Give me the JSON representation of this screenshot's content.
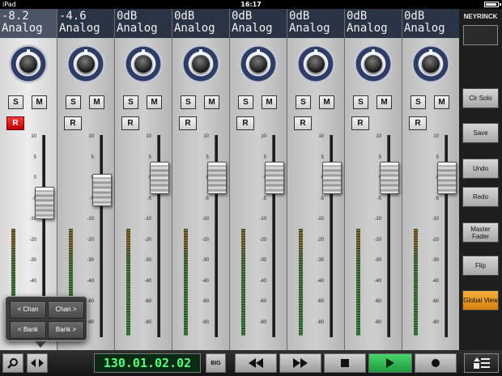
{
  "status": {
    "device": "iPad",
    "time": "16:17"
  },
  "channels": [
    {
      "display": "-8.2",
      "mode": "Analog",
      "solo": "S",
      "mute": "M",
      "rec": "R",
      "rec_armed": true,
      "selected": true,
      "fader_db": -6
    },
    {
      "display": "-4.6",
      "mode": "Analog",
      "solo": "S",
      "mute": "M",
      "rec": "R",
      "rec_armed": false,
      "selected": false,
      "fader_db": -3
    },
    {
      "display": "0dB",
      "mode": "Analog",
      "solo": "S",
      "mute": "M",
      "rec": "R",
      "rec_armed": false,
      "selected": false,
      "fader_db": 0
    },
    {
      "display": "0dB",
      "mode": "Analog",
      "solo": "S",
      "mute": "M",
      "rec": "R",
      "rec_armed": false,
      "selected": false,
      "fader_db": 0
    },
    {
      "display": "0dB",
      "mode": "Analog",
      "solo": "S",
      "mute": "M",
      "rec": "R",
      "rec_armed": false,
      "selected": false,
      "fader_db": 0
    },
    {
      "display": "0dB",
      "mode": "Analog",
      "solo": "S",
      "mute": "M",
      "rec": "R",
      "rec_armed": false,
      "selected": false,
      "fader_db": 0
    },
    {
      "display": "0dB",
      "mode": "Analog",
      "solo": "S",
      "mute": "M",
      "rec": "R",
      "rec_armed": false,
      "selected": false,
      "fader_db": 0
    },
    {
      "display": "0dB",
      "mode": "Analog",
      "solo": "S",
      "mute": "M",
      "rec": "R",
      "rec_armed": false,
      "selected": false,
      "fader_db": 0
    }
  ],
  "scale_ticks": [
    "10",
    "5",
    "0",
    "-5",
    "-10",
    "-20",
    "-30",
    "-40",
    "-60",
    "-80"
  ],
  "right_panel": {
    "brand": "NEYRINCK",
    "buttons": [
      {
        "id": "clr-solo",
        "label": "Clr Solo",
        "active": false
      },
      {
        "id": "save",
        "label": "Save",
        "active": false
      },
      {
        "id": "undo",
        "label": "Undo",
        "active": false
      },
      {
        "id": "redo",
        "label": "Redo",
        "active": false
      },
      {
        "id": "master-fader",
        "label": "Master Fader",
        "active": false
      },
      {
        "id": "flip",
        "label": "Flip",
        "active": false
      },
      {
        "id": "global-view",
        "label": "Global View",
        "active": true
      }
    ]
  },
  "bank_popup": {
    "chan_prev": "< Chan",
    "chan_next": "Chan >",
    "bank_prev": "< Bank",
    "bank_next": "Bank >"
  },
  "transport": {
    "timecode": "130.01.02.02",
    "big_label": "BIG",
    "icons": [
      "search-icon",
      "bank-arrows-icon",
      "rewind-icon",
      "fast-forward-icon",
      "stop-icon",
      "play-icon",
      "record-icon",
      "menu-list-icon"
    ]
  },
  "colors": {
    "rec_armed": "#e00000",
    "timecode_text": "#4eff7a",
    "play_active": "#2fb54f",
    "global_view": "#f0a020"
  }
}
